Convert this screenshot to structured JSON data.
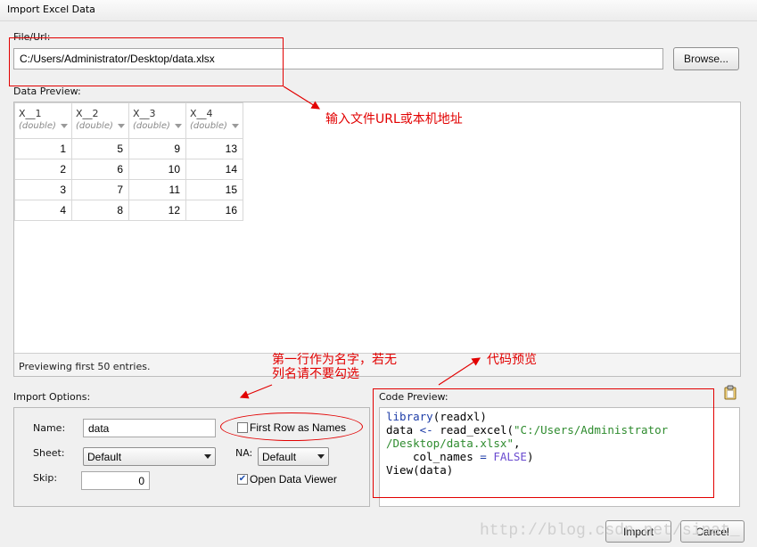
{
  "window": {
    "title": "Import Excel Data"
  },
  "file": {
    "label": "File/Url:",
    "value": "C:/Users/Administrator/Desktop/data.xlsx",
    "browse_label": "Browse..."
  },
  "preview": {
    "label": "Data Preview:",
    "columns": [
      {
        "name": "X__1",
        "type": "(double)"
      },
      {
        "name": "X__2",
        "type": "(double)"
      },
      {
        "name": "X__3",
        "type": "(double)"
      },
      {
        "name": "X__4",
        "type": "(double)"
      }
    ],
    "rows": [
      [
        "1",
        "5",
        "9",
        "13"
      ],
      [
        "2",
        "6",
        "10",
        "14"
      ],
      [
        "3",
        "7",
        "11",
        "15"
      ],
      [
        "4",
        "8",
        "12",
        "16"
      ]
    ],
    "footer": "Previewing first 50 entries."
  },
  "options": {
    "label": "Import Options:",
    "name_label": "Name:",
    "name_value": "data",
    "sheet_label": "Sheet:",
    "sheet_value": "Default",
    "skip_label": "Skip:",
    "skip_value": "0",
    "na_label": "NA:",
    "na_value": "Default",
    "first_row_label": "First Row as Names",
    "first_row_checked": false,
    "open_viewer_label": "Open Data Viewer",
    "open_viewer_checked": true
  },
  "code": {
    "label": "Code Preview:",
    "fn_library": "library",
    "pkg": "(readxl)",
    "var": "data",
    "assign": "<-",
    "fn_read": "read_excel(",
    "path_part1": "\"C:/Users/Administrator",
    "path_part2": "/Desktop/data.xlsx\"",
    "comma": ",",
    "arg": "col_names",
    "eq": "=",
    "false_val": "FALSE",
    "close": ")",
    "view_line": "View(data)"
  },
  "buttons": {
    "import_label": "Import",
    "cancel_label": "Cancel"
  },
  "annotations": {
    "url_note": "输入文件URL或本机地址",
    "names_note_1": "第一行作为名字，若无",
    "names_note_2": "列名请不要勾选",
    "code_note": "代码预览",
    "watermark": "http://blog.csdn.net/sinat_"
  },
  "colors": {
    "annotation": "#e20000",
    "keyword": "#1f3ea8",
    "string": "#2e8b2e",
    "constant": "#6a4bd0"
  }
}
